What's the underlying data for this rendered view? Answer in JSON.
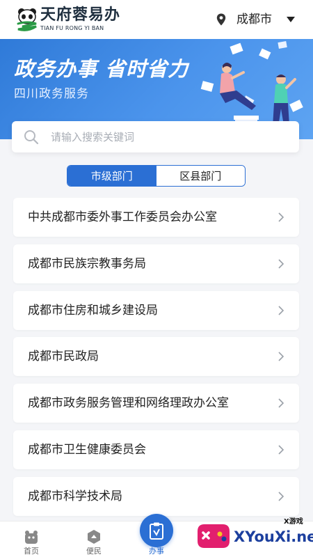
{
  "header": {
    "brand_cn": "天府蓉易办",
    "brand_en": "TIAN FU RONG YI BAN",
    "city": "成都市",
    "icons": {
      "logo": "panda-logo-icon",
      "location": "location-pin-icon",
      "dropdown": "caret-down-icon"
    }
  },
  "banner": {
    "title": "政务办事  省时省力",
    "subtitle": "四川政务服务"
  },
  "search": {
    "placeholder": "请输入搜索关键词",
    "value": ""
  },
  "tabs": [
    {
      "label": "市级部门",
      "active": true
    },
    {
      "label": "区县部门",
      "active": false
    }
  ],
  "departments": [
    "中共成都市委外事工作委员会办公室",
    "成都市民族宗教事务局",
    "成都市住房和城乡建设局",
    "成都市民政局",
    "成都市政务服务管理和网络理政办公室",
    "成都市卫生健康委员会",
    "成都市科学技术局"
  ],
  "bottom_nav": [
    {
      "label": "首页",
      "icon": "home-icon"
    },
    {
      "label": "便民",
      "icon": "service-icon"
    },
    {
      "label": "办事",
      "icon": "clipboard-icon",
      "active": true
    }
  ],
  "watermark": {
    "site": "XYouXi.net",
    "tag": "X游戏"
  },
  "colors": {
    "accent": "#2b6fd4",
    "banner": "#3d88e4",
    "background": "#f4f5f8",
    "brand_green": "#2a9a45"
  }
}
